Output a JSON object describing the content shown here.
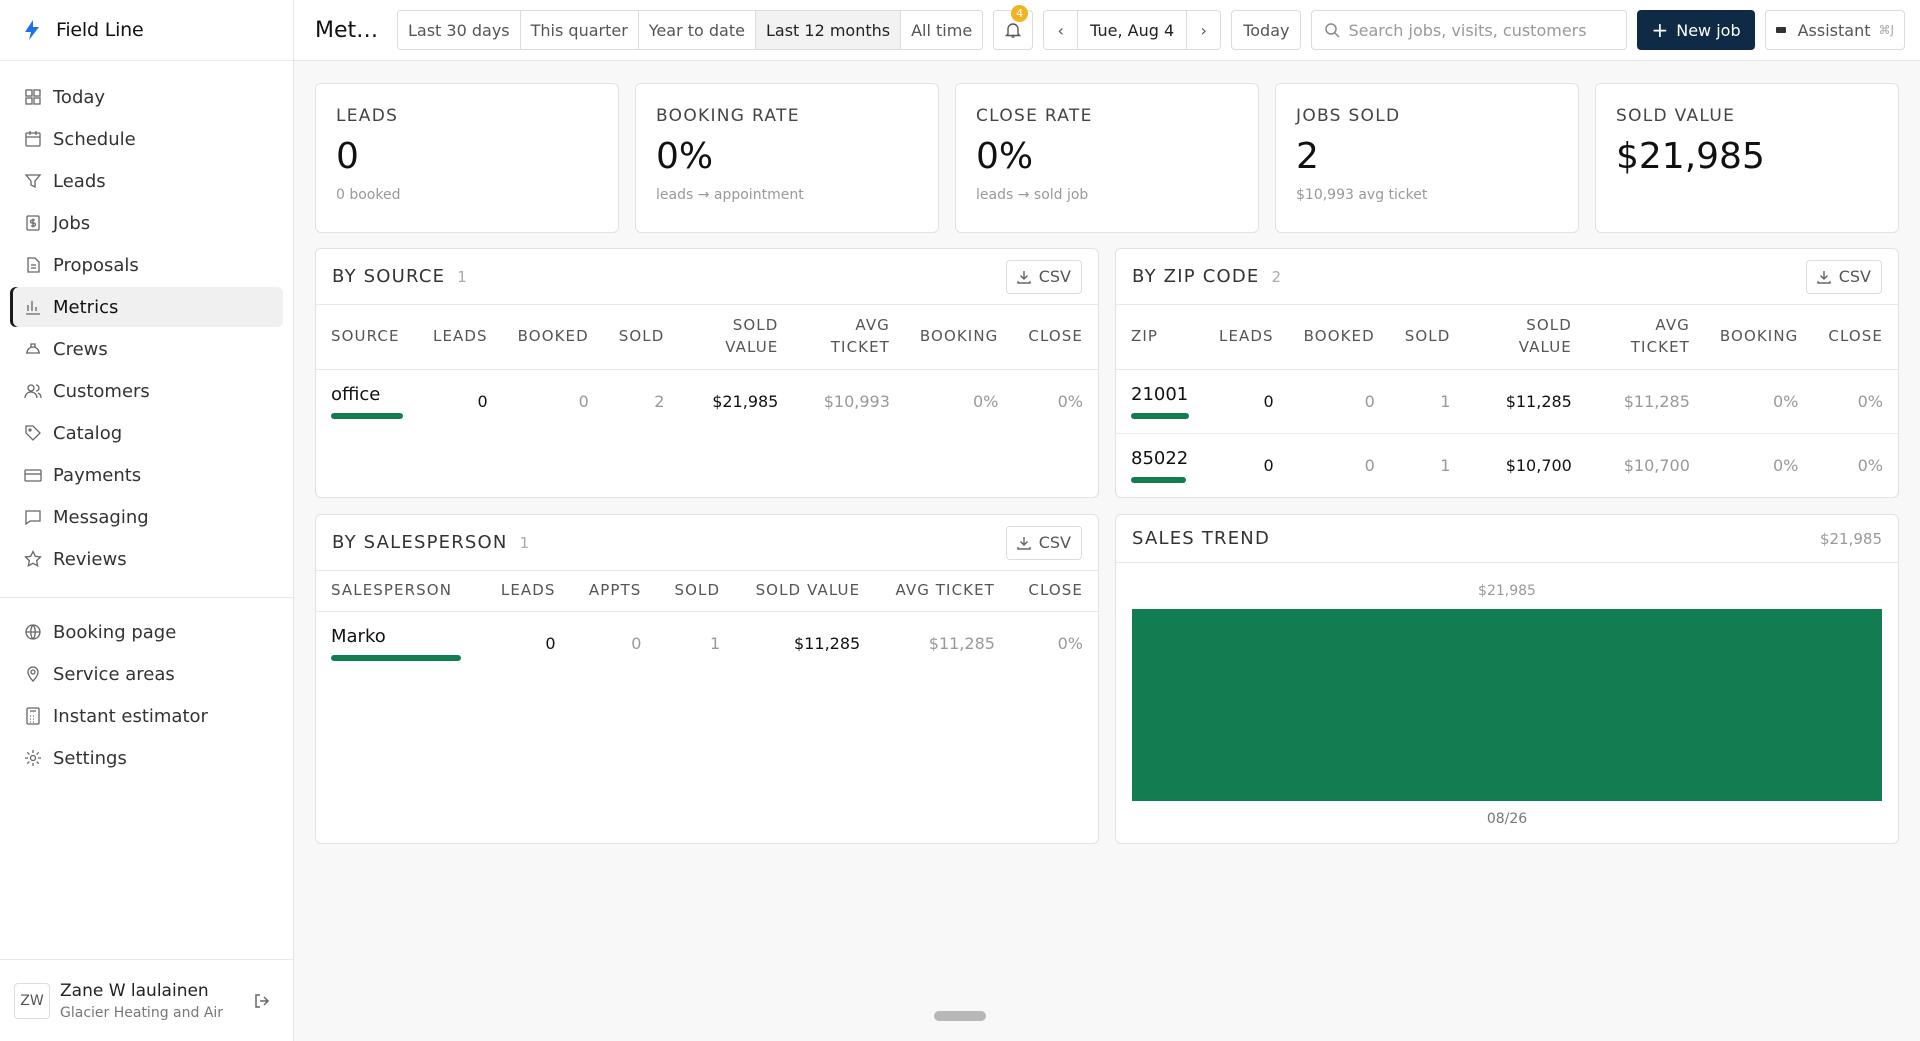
{
  "brand": {
    "name": "Field Line"
  },
  "sidebar": {
    "items": [
      {
        "label": "Today",
        "icon": "grid-icon"
      },
      {
        "label": "Schedule",
        "icon": "calendar-icon"
      },
      {
        "label": "Leads",
        "icon": "funnel-icon"
      },
      {
        "label": "Jobs",
        "icon": "dollar-doc-icon"
      },
      {
        "label": "Proposals",
        "icon": "document-icon"
      },
      {
        "label": "Metrics",
        "icon": "bar-chart-icon",
        "active": true
      },
      {
        "label": "Crews",
        "icon": "hard-hat-icon"
      },
      {
        "label": "Customers",
        "icon": "users-icon"
      },
      {
        "label": "Catalog",
        "icon": "tag-icon"
      },
      {
        "label": "Payments",
        "icon": "credit-card-icon"
      },
      {
        "label": "Messaging",
        "icon": "message-icon"
      },
      {
        "label": "Reviews",
        "icon": "star-icon"
      }
    ],
    "secondary": [
      {
        "label": "Booking page",
        "icon": "globe-icon"
      },
      {
        "label": "Service areas",
        "icon": "map-pin-icon"
      },
      {
        "label": "Instant estimator",
        "icon": "calculator-icon"
      },
      {
        "label": "Settings",
        "icon": "gear-icon"
      }
    ]
  },
  "user": {
    "initials": "ZW",
    "name": "Zane W laulainen",
    "org": "Glacier Heating and Air"
  },
  "header": {
    "title": "Metrics",
    "ranges": [
      "Last 30 days",
      "This quarter",
      "Year to date",
      "Last 12 months",
      "All time"
    ],
    "active_range": "Last 12 months",
    "notifications": "4",
    "date": "Tue, Aug 4",
    "today": "Today",
    "search_placeholder": "Search jobs, visits, customers",
    "new_job": "New job",
    "assistant": "Assistant",
    "assistant_kbd": "⌘J"
  },
  "kpis": [
    {
      "label": "LEADS",
      "value": "0",
      "sub": "0 booked"
    },
    {
      "label": "BOOKING RATE",
      "value": "0%",
      "sub": "leads → appointment"
    },
    {
      "label": "CLOSE RATE",
      "value": "0%",
      "sub": "leads → sold job"
    },
    {
      "label": "JOBS SOLD",
      "value": "2",
      "sub": "$10,993 avg ticket"
    },
    {
      "label": "SOLD VALUE",
      "value": "$21,985",
      "sub": ""
    }
  ],
  "by_source": {
    "title": "BY SOURCE",
    "count": "1",
    "csv": "CSV",
    "headers": [
      "SOURCE",
      "LEADS",
      "BOOKED",
      "SOLD",
      "SOLD VALUE",
      "AVG TICKET",
      "BOOKING",
      "CLOSE"
    ],
    "rows": [
      {
        "name": "office",
        "share": 1.0,
        "cells": [
          "0",
          "0",
          "2",
          "$21,985",
          "$10,993",
          "0%",
          "0%"
        ]
      }
    ]
  },
  "by_zip": {
    "title": "BY ZIP CODE",
    "count": "2",
    "csv": "CSV",
    "headers": [
      "ZIP",
      "LEADS",
      "BOOKED",
      "SOLD",
      "SOLD VALUE",
      "AVG TICKET",
      "BOOKING",
      "CLOSE"
    ],
    "rows": [
      {
        "name": "21001",
        "share": 1.0,
        "cells": [
          "0",
          "0",
          "1",
          "$11,285",
          "$11,285",
          "0%",
          "0%"
        ]
      },
      {
        "name": "85022",
        "share": 0.95,
        "cells": [
          "0",
          "0",
          "1",
          "$10,700",
          "$10,700",
          "0%",
          "0%"
        ]
      }
    ]
  },
  "by_salesperson": {
    "title": "BY SALESPERSON",
    "count": "1",
    "csv": "CSV",
    "headers": [
      "SALESPERSON",
      "LEADS",
      "APPTS",
      "SOLD",
      "SOLD VALUE",
      "AVG TICKET",
      "CLOSE"
    ],
    "rows": [
      {
        "name": "Marko",
        "share": 1.0,
        "cells": [
          "0",
          "0",
          "1",
          "$11,285",
          "$11,285",
          "0%"
        ]
      }
    ]
  },
  "sales_trend": {
    "title": "SALES TREND",
    "total": "$21,985"
  },
  "chart_data": {
    "type": "bar",
    "categories": [
      "08/26"
    ],
    "values": [
      21985
    ],
    "title": "SALES TREND",
    "data_labels": [
      "$21,985"
    ],
    "ylim": [
      0,
      21985
    ]
  },
  "colors": {
    "accent": "#137d52",
    "primary": "#0f2a45",
    "badge": "#f2b320"
  }
}
